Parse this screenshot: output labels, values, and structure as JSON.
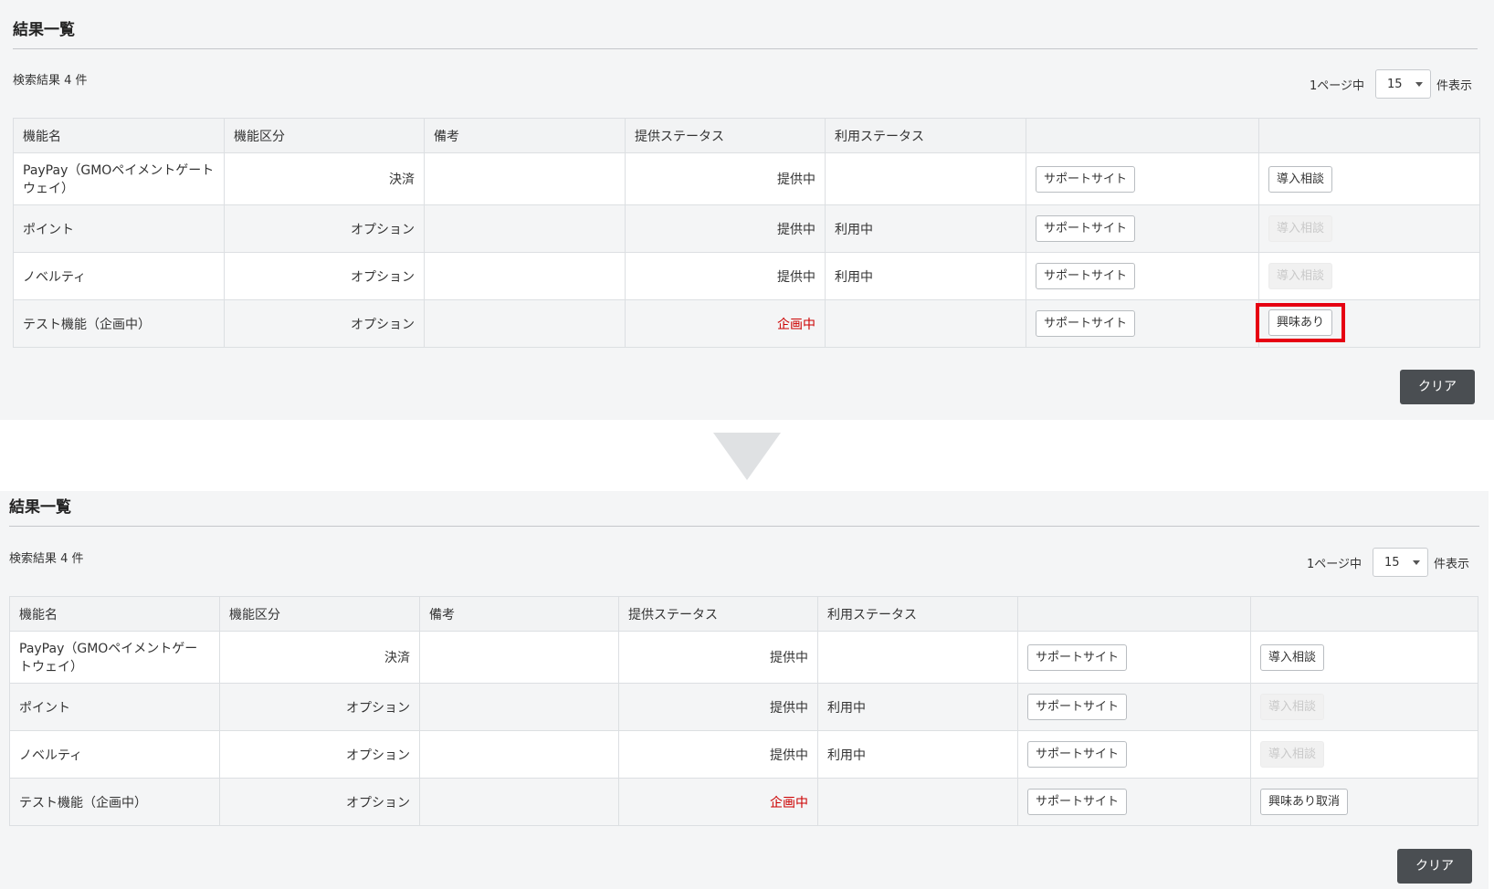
{
  "before": {
    "section_title": "結果一覧",
    "result_count": "検索結果 4 件",
    "pager": {
      "prefix": "1ページ中",
      "per_page": "15",
      "suffix": "件表示"
    },
    "columns": [
      "機能名",
      "機能区分",
      "備考",
      "提供ステータス",
      "利用ステータス",
      "",
      ""
    ],
    "rows": [
      {
        "name": "PayPay（GMOペイメントゲートウェイ）",
        "category": "決済",
        "note": "",
        "provide_status": "提供中",
        "use_status": "",
        "support_label": "サポートサイト",
        "action_label": "導入相談",
        "action_state": "enabled"
      },
      {
        "name": "ポイント",
        "category": "オプション",
        "note": "",
        "provide_status": "提供中",
        "use_status": "利用中",
        "support_label": "サポートサイト",
        "action_label": "導入相談",
        "action_state": "disabled"
      },
      {
        "name": "ノベルティ",
        "category": "オプション",
        "note": "",
        "provide_status": "提供中",
        "use_status": "利用中",
        "support_label": "サポートサイト",
        "action_label": "導入相談",
        "action_state": "disabled"
      },
      {
        "name": "テスト機能（企画中）",
        "category": "オプション",
        "note": "",
        "provide_status": "企画中",
        "use_status": "",
        "support_label": "サポートサイト",
        "action_label": "興味あり",
        "action_state": "highlighted"
      }
    ],
    "clear_label": "クリア"
  },
  "after": {
    "section_title": "結果一覧",
    "result_count": "検索結果 4 件",
    "pager": {
      "prefix": "1ページ中",
      "per_page": "15",
      "suffix": "件表示"
    },
    "columns": [
      "機能名",
      "機能区分",
      "備考",
      "提供ステータス",
      "利用ステータス",
      "",
      ""
    ],
    "rows": [
      {
        "name": "PayPay（GMOペイメントゲートウェイ）",
        "category": "決済",
        "note": "",
        "provide_status": "提供中",
        "use_status": "",
        "support_label": "サポートサイト",
        "action_label": "導入相談",
        "action_state": "enabled"
      },
      {
        "name": "ポイント",
        "category": "オプション",
        "note": "",
        "provide_status": "提供中",
        "use_status": "利用中",
        "support_label": "サポートサイト",
        "action_label": "導入相談",
        "action_state": "disabled"
      },
      {
        "name": "ノベルティ",
        "category": "オプション",
        "note": "",
        "provide_status": "提供中",
        "use_status": "利用中",
        "support_label": "サポートサイト",
        "action_label": "導入相談",
        "action_state": "disabled"
      },
      {
        "name": "テスト機能（企画中）",
        "category": "オプション",
        "note": "",
        "provide_status": "企画中",
        "use_status": "",
        "support_label": "サポートサイト",
        "action_label": "興味あり取消",
        "action_state": "enabled"
      }
    ],
    "clear_label": "クリア"
  },
  "colors": {
    "planned_status": "#cc0000",
    "highlight_border": "#e60012",
    "clear_button": "#4a4e52",
    "arrow": "#dfe1e3"
  },
  "icons": {
    "select_caret": "caret-down-icon",
    "transition_arrow": "down-triangle-icon"
  }
}
